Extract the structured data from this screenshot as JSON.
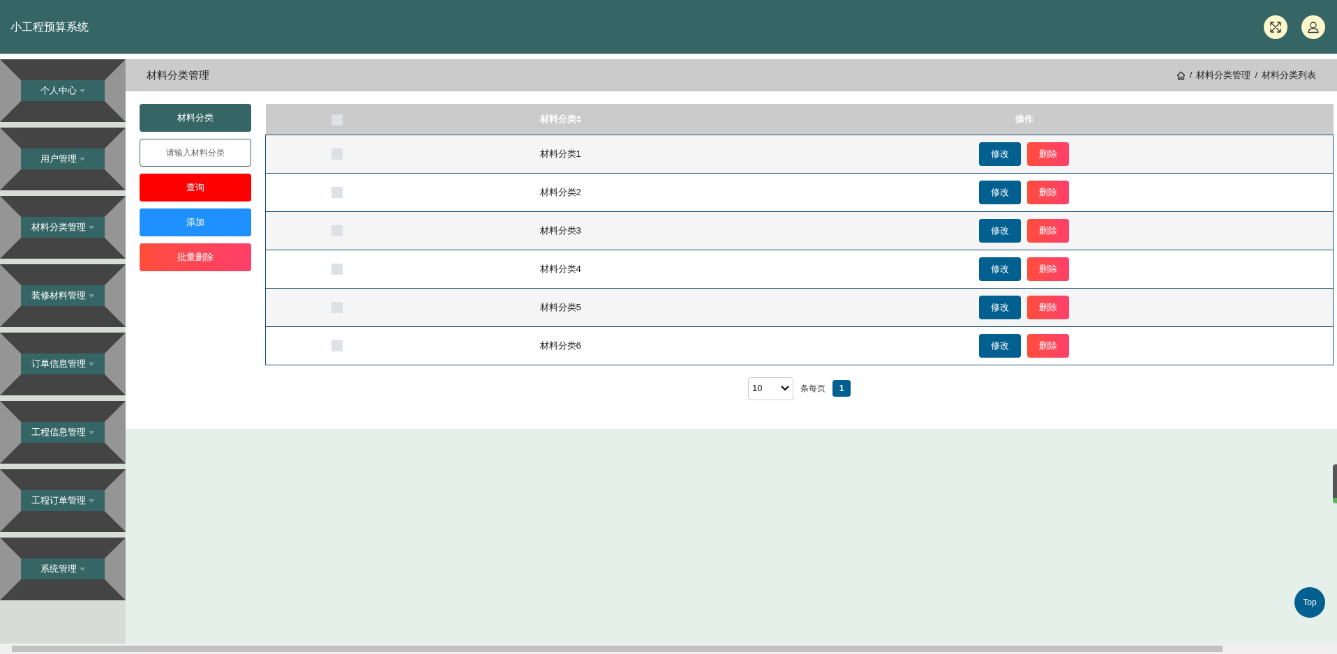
{
  "header": {
    "title": "小工程预算系统"
  },
  "sidebar": {
    "items": [
      {
        "label": "个人中心",
        "expanded": false
      },
      {
        "label": "用户管理",
        "expanded": false
      },
      {
        "label": "材料分类管理",
        "expanded": false
      },
      {
        "label": "装修材料管理",
        "expanded": false
      },
      {
        "label": "订单信息管理",
        "expanded": false
      },
      {
        "label": "工程信息管理",
        "expanded": false
      },
      {
        "label": "工程订单管理",
        "expanded": false
      },
      {
        "label": "系统管理",
        "expanded": false
      }
    ]
  },
  "page_title": "材料分类管理",
  "breadcrumb": [
    "材料分类管理",
    "材料分类列表"
  ],
  "breadcrumb_separator": "/",
  "search": {
    "label": "材料分类",
    "placeholder": "请输入材料分类"
  },
  "actions": [
    {
      "label": "查询",
      "kind": "query"
    },
    {
      "label": "添加",
      "kind": "add"
    },
    {
      "label": "批量删除",
      "kind": "batch-delete"
    }
  ],
  "table": {
    "all_selected": false,
    "columns": [
      "材料分类",
      "操作"
    ],
    "rows": [
      {
        "name": "材料分类1",
        "selected": false,
        "actions": [
          "修改",
          "删除"
        ]
      },
      {
        "name": "材料分类2",
        "selected": false,
        "actions": [
          "修改",
          "删除"
        ]
      },
      {
        "name": "材料分类3",
        "selected": false,
        "actions": [
          "修改",
          "删除"
        ]
      },
      {
        "name": "材料分类4",
        "selected": false,
        "actions": [
          "修改",
          "删除"
        ]
      },
      {
        "name": "材料分类5",
        "selected": false,
        "actions": [
          "修改",
          "删除"
        ]
      },
      {
        "name": "材料分类6",
        "selected": false,
        "actions": [
          "修改",
          "删除"
        ]
      }
    ]
  },
  "pagination": {
    "page_size": "10",
    "page_size_label": "条每页",
    "pages": [
      {
        "label": "1",
        "selected": true
      }
    ]
  },
  "top_button": "Top"
}
